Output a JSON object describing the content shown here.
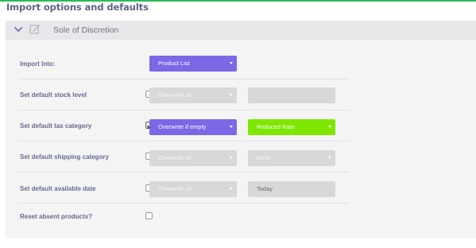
{
  "page": {
    "title": "Import options and defaults"
  },
  "panel": {
    "title": "Sole of Discretion"
  },
  "rows": [
    {
      "label": "Import Into:",
      "select": "Product List"
    },
    {
      "label": "Set default stock level",
      "checked": false,
      "select": "Overwrite all",
      "field": ""
    },
    {
      "label": "Set default tax category",
      "checked": true,
      "select": "Overwrite if empty",
      "field": "Reduced Rate"
    },
    {
      "label": "Set default shipping category",
      "checked": false,
      "select": "Overwrite all",
      "field": "None"
    },
    {
      "label": "Set default available date",
      "checked": false,
      "select": "Overwrite all",
      "field": "Today"
    },
    {
      "label": "Reset absent products?",
      "checked": false
    }
  ],
  "colors": {
    "accent_purple": "#7a68e6",
    "accent_green": "#7fe600",
    "top_border": "#2dbb57",
    "label_text": "#646a8f"
  },
  "icons": {
    "header_toggle": "chevron-down-icon",
    "header_edit": "edit-icon",
    "dropdown": "caret-down-icon"
  }
}
